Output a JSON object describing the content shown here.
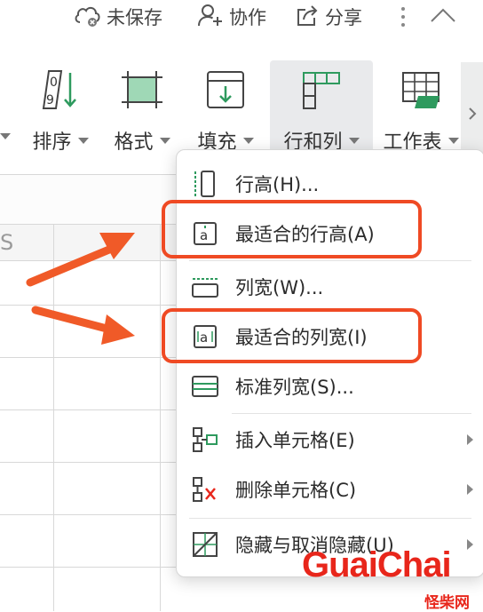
{
  "topbar": {
    "unsaved_label": "未保存",
    "collab_label": "协作",
    "share_label": "分享"
  },
  "ribbon": {
    "tools": [
      {
        "label": "排序"
      },
      {
        "label": "格式"
      },
      {
        "label": "填充"
      },
      {
        "label": "行和列"
      },
      {
        "label": "工作表"
      }
    ]
  },
  "sheet": {
    "col_header_partial": "S"
  },
  "menu": {
    "items": [
      {
        "label": "行高(H)..."
      },
      {
        "label": "最适合的行高(A)"
      },
      {
        "label": "列宽(W)..."
      },
      {
        "label": "最适合的列宽(I)"
      },
      {
        "label": "标准列宽(S)..."
      },
      {
        "label": "插入单元格(E)"
      },
      {
        "label": "删除单元格(C)"
      },
      {
        "label": "隐藏与取消隐藏(U)"
      }
    ]
  },
  "colors": {
    "accent_green": "#2e9a5e",
    "highlight_red": "#ef4a24",
    "arrow_red": "#f05a28",
    "watermark_red": "#e8261b"
  },
  "watermark": {
    "brand": "GuaiChai",
    "sub": "怪柴网"
  }
}
